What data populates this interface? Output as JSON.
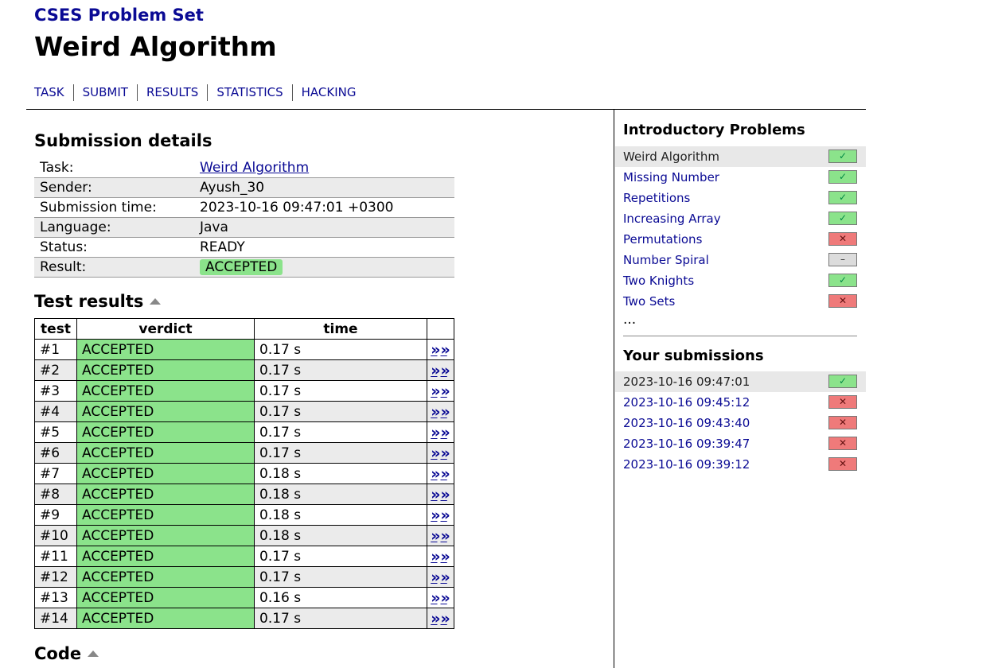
{
  "header": {
    "site_title": "CSES Problem Set",
    "page_title": "Weird Algorithm",
    "nav": [
      "TASK",
      "SUBMIT",
      "RESULTS",
      "STATISTICS",
      "HACKING"
    ]
  },
  "submission": {
    "heading": "Submission details",
    "rows": [
      {
        "label": "Task:",
        "value": "Weird Algorithm"
      },
      {
        "label": "Sender:",
        "value": "Ayush_30"
      },
      {
        "label": "Submission time:",
        "value": "2023-10-16 09:47:01 +0300"
      },
      {
        "label": "Language:",
        "value": "Java"
      },
      {
        "label": "Status:",
        "value": "READY"
      },
      {
        "label": "Result:",
        "value": "ACCEPTED"
      }
    ]
  },
  "tests": {
    "heading": "Test results",
    "columns": [
      "test",
      "verdict",
      "time",
      ""
    ],
    "go_symbol": "»",
    "rows": [
      {
        "test": "#1",
        "verdict": "ACCEPTED",
        "time": "0.17 s"
      },
      {
        "test": "#2",
        "verdict": "ACCEPTED",
        "time": "0.17 s"
      },
      {
        "test": "#3",
        "verdict": "ACCEPTED",
        "time": "0.17 s"
      },
      {
        "test": "#4",
        "verdict": "ACCEPTED",
        "time": "0.17 s"
      },
      {
        "test": "#5",
        "verdict": "ACCEPTED",
        "time": "0.17 s"
      },
      {
        "test": "#6",
        "verdict": "ACCEPTED",
        "time": "0.17 s"
      },
      {
        "test": "#7",
        "verdict": "ACCEPTED",
        "time": "0.18 s"
      },
      {
        "test": "#8",
        "verdict": "ACCEPTED",
        "time": "0.18 s"
      },
      {
        "test": "#9",
        "verdict": "ACCEPTED",
        "time": "0.18 s"
      },
      {
        "test": "#10",
        "verdict": "ACCEPTED",
        "time": "0.18 s"
      },
      {
        "test": "#11",
        "verdict": "ACCEPTED",
        "time": "0.17 s"
      },
      {
        "test": "#12",
        "verdict": "ACCEPTED",
        "time": "0.17 s"
      },
      {
        "test": "#13",
        "verdict": "ACCEPTED",
        "time": "0.16 s"
      },
      {
        "test": "#14",
        "verdict": "ACCEPTED",
        "time": "0.17 s"
      }
    ]
  },
  "code": {
    "heading": "Code"
  },
  "sidebar": {
    "section_title": "Introductory Problems",
    "problems": [
      {
        "name": "Weird Algorithm",
        "status": "accepted",
        "current": true
      },
      {
        "name": "Missing Number",
        "status": "accepted"
      },
      {
        "name": "Repetitions",
        "status": "accepted"
      },
      {
        "name": "Increasing Array",
        "status": "accepted"
      },
      {
        "name": "Permutations",
        "status": "failed"
      },
      {
        "name": "Number Spiral",
        "status": "none"
      },
      {
        "name": "Two Knights",
        "status": "accepted"
      },
      {
        "name": "Two Sets",
        "status": "failed"
      }
    ],
    "more": "...",
    "submissions_title": "Your submissions",
    "submissions": [
      {
        "time": "2023-10-16 09:47:01",
        "status": "accepted",
        "current": true
      },
      {
        "time": "2023-10-16 09:45:12",
        "status": "failed"
      },
      {
        "time": "2023-10-16 09:43:40",
        "status": "failed"
      },
      {
        "time": "2023-10-16 09:39:47",
        "status": "failed"
      },
      {
        "time": "2023-10-16 09:39:12",
        "status": "failed"
      }
    ],
    "status_glyphs": {
      "accepted": "✓",
      "failed": "✕",
      "none": "–"
    }
  },
  "colors": {
    "link": "#0a0a94",
    "accepted": "#8be38b",
    "failed": "#ef7a7a",
    "row_alt": "#ebebeb"
  }
}
